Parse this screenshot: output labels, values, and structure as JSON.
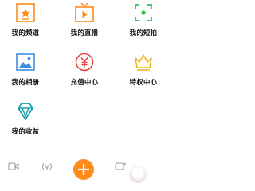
{
  "grid": {
    "items": [
      {
        "label": "我的频道",
        "icon": "channel-star-icon"
      },
      {
        "label": "我的直播",
        "icon": "live-play-icon"
      },
      {
        "label": "我的短拍",
        "icon": "short-video-icon"
      },
      {
        "label": "我的相册",
        "icon": "photo-album-icon"
      },
      {
        "label": "充值中心",
        "icon": "recharge-yen-icon"
      },
      {
        "label": "特权中心",
        "icon": "privilege-crown-icon"
      },
      {
        "label": "我的收益",
        "icon": "earnings-diamond-icon"
      }
    ]
  },
  "tabbar": {
    "tabs": [
      {
        "label": "",
        "icon": "video-camera-icon"
      },
      {
        "label": "",
        "icon": "broadcast-icon"
      },
      {
        "label": "",
        "icon": "add-icon"
      },
      {
        "label": "",
        "icon": "chat-icon"
      }
    ]
  },
  "colors": {
    "accent": "#ff8b1a",
    "label": "#111111",
    "inactive": "#999999"
  }
}
